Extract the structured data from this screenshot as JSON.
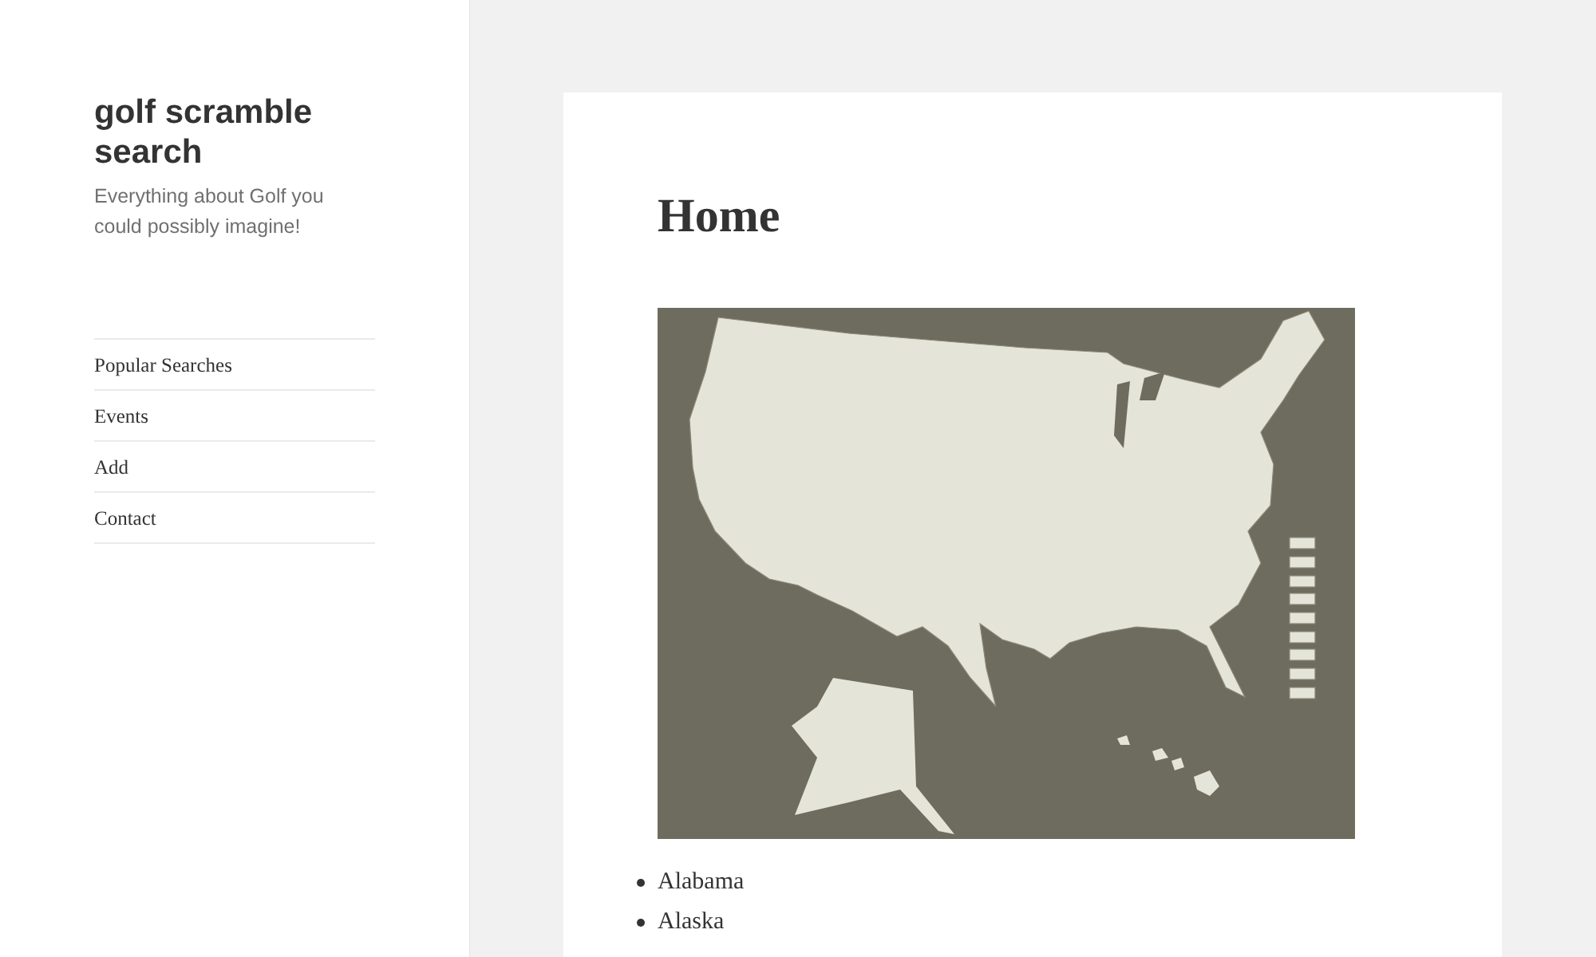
{
  "site": {
    "title": "golf scramble search",
    "tagline": "Everything about Golf you could possibly imagine!"
  },
  "nav": [
    {
      "label": "Popular Searches"
    },
    {
      "label": "Events"
    },
    {
      "label": "Add"
    },
    {
      "label": "Contact"
    }
  ],
  "page": {
    "title": "Home",
    "list": [
      "Alabama",
      "Alaska"
    ]
  }
}
